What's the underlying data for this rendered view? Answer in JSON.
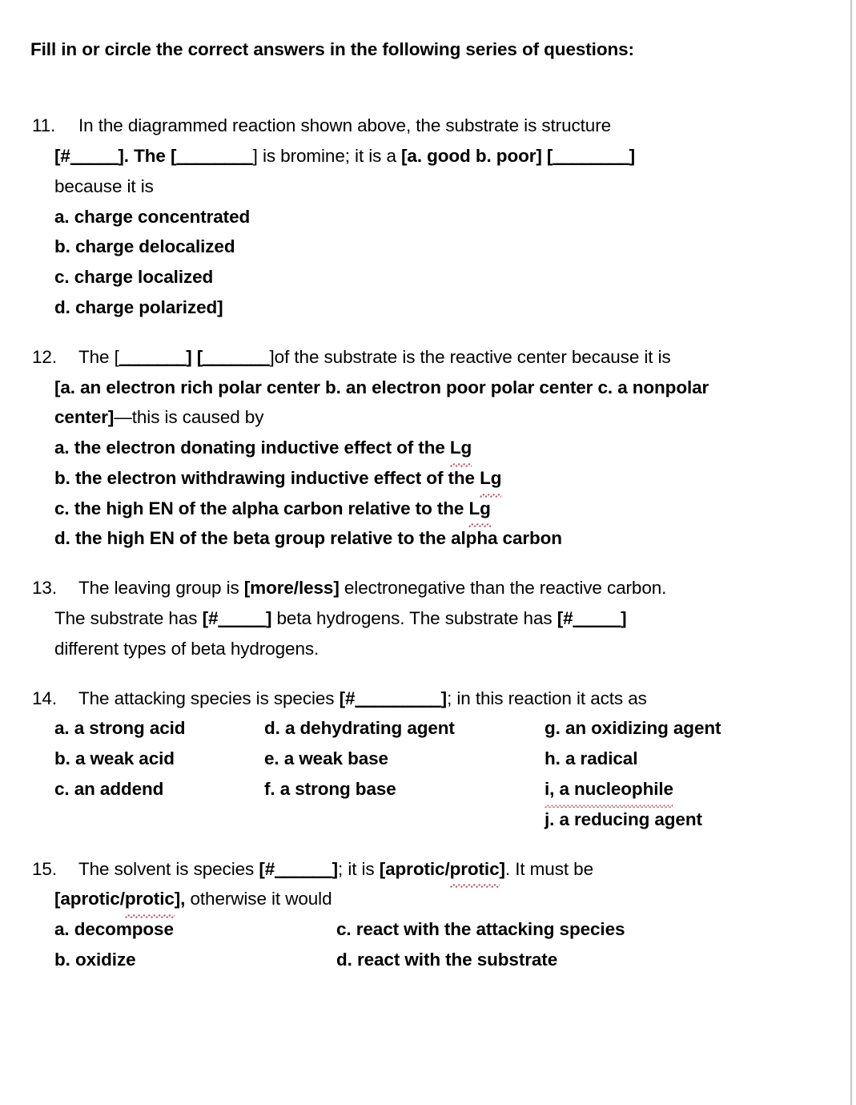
{
  "document": {
    "heading": "Fill in or circle the correct answers in the following series of questions:"
  },
  "questions": [
    {
      "number": "11.",
      "line1_text": "In the diagrammed reaction shown above, the substrate is structure",
      "line2_a": "[#",
      "line2_blank1": "_____",
      "line2_b": "]. The [",
      "line2_blank2": "________",
      "line2_c": "] is bromine; it is a ",
      "line2_bold": "[a. good  b. poor] [",
      "line2_blank3": "________",
      "line2_d": "]",
      "line3_text": "because it is",
      "options": [
        "a. charge concentrated",
        "b. charge delocalized",
        "c. charge localized",
        "d. charge polarized]"
      ]
    },
    {
      "number": "12.",
      "line1_a": "The [",
      "line1_blank1": "_______",
      "line1_b": "] [",
      "line1_blank2": "_______",
      "line1_c": "]of the substrate is the reactive center because it is",
      "line2_bold": "[a. an electron rich polar center b. an electron poor polar center  c. a nonpolar",
      "line3_bold": "center]",
      "line3_rest": "—this is caused by",
      "options": [
        {
          "pre": "a. the electron donating inductive effect of the ",
          "flagged": "Lg"
        },
        {
          "pre": "b. the electron withdrawing inductive effect of the ",
          "flagged": "Lg"
        },
        {
          "pre": "c. the high EN of the alpha carbon relative to the ",
          "flagged": "Lg"
        },
        {
          "pre": "d. the high EN of the beta group relative to the alpha carbon",
          "flagged": ""
        }
      ]
    },
    {
      "number": "13.",
      "line1_a": "The leaving group is ",
      "line1_bold": "[more/less]",
      "line1_b": " electronegative than the reactive carbon.",
      "line2_a": "The substrate has ",
      "line2_bold1": "[#",
      "line2_blank1": "_____",
      "line2_bold2": "]",
      "line2_b": " beta hydrogens. The substrate has ",
      "line2_bold3": "[#",
      "line2_blank2": "_____",
      "line2_bold4": "]",
      "line3_text": "different types of beta hydrogens."
    },
    {
      "number": "14.",
      "line1_a": "The attacking species is species ",
      "line1_bold": "[#",
      "line1_blank": "_________",
      "line1_bold2": "]",
      "line1_b": "; in this reaction it acts as",
      "grid": [
        [
          "a. a strong acid",
          "d. a dehydrating agent",
          "g. an oxidizing agent"
        ],
        [
          "b. a weak acid",
          "e. a weak base",
          "h. a radical"
        ],
        [
          "c. an addend",
          "f. a strong base",
          "i, a nucleophile"
        ],
        [
          "",
          "",
          "j. a reducing agent"
        ]
      ],
      "flagged_cell": "i, a nucleophile"
    },
    {
      "number": "15.",
      "line1_a": "The solvent is species ",
      "line1_bold": "[#",
      "line1_blank": "______",
      "line1_bold2": "]",
      "line1_b": "; it is ",
      "line1_bold3": "[aprotic/",
      "line1_flagged": "protic",
      "line1_bold4": "]",
      "line1_c": ". It must be",
      "line2_bold": "[aprotic/",
      "line2_flagged": "protic",
      "line2_bold2": "],",
      "line2_rest": " otherwise it would",
      "grid": [
        [
          "a. decompose",
          "c. react with the attacking species"
        ],
        [
          "b. oxidize",
          "d. react with the substrate"
        ]
      ]
    }
  ],
  "colors": {
    "text": "#000000",
    "page_background": "#ffffff",
    "right_rule": "#c4c4c4",
    "spellcheck_underline": "#b03a48"
  }
}
